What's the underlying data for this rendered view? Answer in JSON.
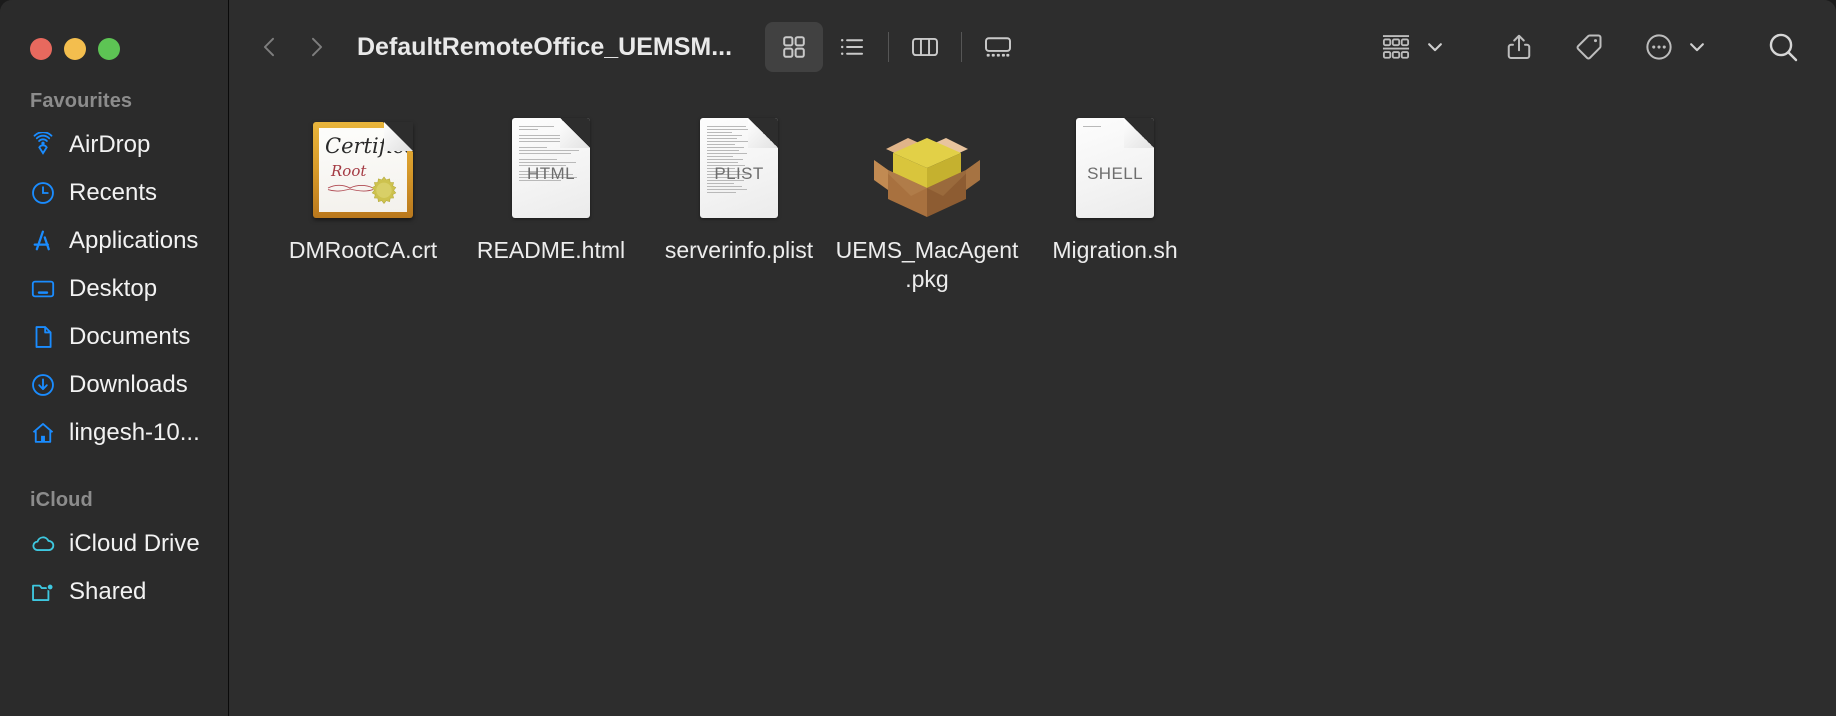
{
  "window": {
    "title": "DefaultRemoteOffice_UEMSM...",
    "traffic_lights": [
      {
        "name": "close",
        "color": "#e8695e"
      },
      {
        "name": "minimize",
        "color": "#f3be4e"
      },
      {
        "name": "maximize",
        "color": "#5dc454"
      }
    ]
  },
  "sidebar": {
    "sections": [
      {
        "header": "Favourites",
        "items": [
          {
            "label": "AirDrop",
            "icon": "airdrop-icon"
          },
          {
            "label": "Recents",
            "icon": "clock-icon"
          },
          {
            "label": "Applications",
            "icon": "applications-icon"
          },
          {
            "label": "Desktop",
            "icon": "desktop-icon"
          },
          {
            "label": "Documents",
            "icon": "document-icon"
          },
          {
            "label": "Downloads",
            "icon": "download-icon"
          },
          {
            "label": "lingesh-10...",
            "icon": "home-icon"
          }
        ]
      },
      {
        "header": "iCloud",
        "items": [
          {
            "label": "iCloud Drive",
            "icon": "cloud-icon"
          },
          {
            "label": "Shared",
            "icon": "shared-folder-icon"
          }
        ]
      }
    ]
  },
  "toolbar": {
    "back": "back-chevron",
    "forward": "forward-chevron",
    "view_modes": [
      {
        "name": "icon-view",
        "active": true
      },
      {
        "name": "list-view",
        "active": false
      },
      {
        "name": "column-view",
        "active": false
      },
      {
        "name": "gallery-view",
        "active": false
      }
    ],
    "group_button": "group-items-icon",
    "share_button": "share-icon",
    "tag_button": "tag-icon",
    "more_button": "more-actions-icon",
    "search_button": "search-icon"
  },
  "files": [
    {
      "name": "DMRootCA.crt",
      "icon": "certificate-icon",
      "kind_badge": ""
    },
    {
      "name": "README.html",
      "icon": "document-icon",
      "kind_badge": "HTML"
    },
    {
      "name": "serverinfo.plist",
      "icon": "document-icon",
      "kind_badge": "PLIST"
    },
    {
      "name": "UEMS_MacAgent.pkg",
      "icon": "package-box-icon",
      "kind_badge": ""
    },
    {
      "name": "Migration.sh",
      "icon": "document-icon",
      "kind_badge": "SHELL"
    }
  ],
  "colors": {
    "window_bg": "#2d2d2d",
    "sidebar_bg": "#2b2b2b",
    "accent_blue": "#1a8cff",
    "accent_cyan": "#3ec8e0",
    "text_primary": "#ededed",
    "text_secondary": "#8c8c8c"
  }
}
